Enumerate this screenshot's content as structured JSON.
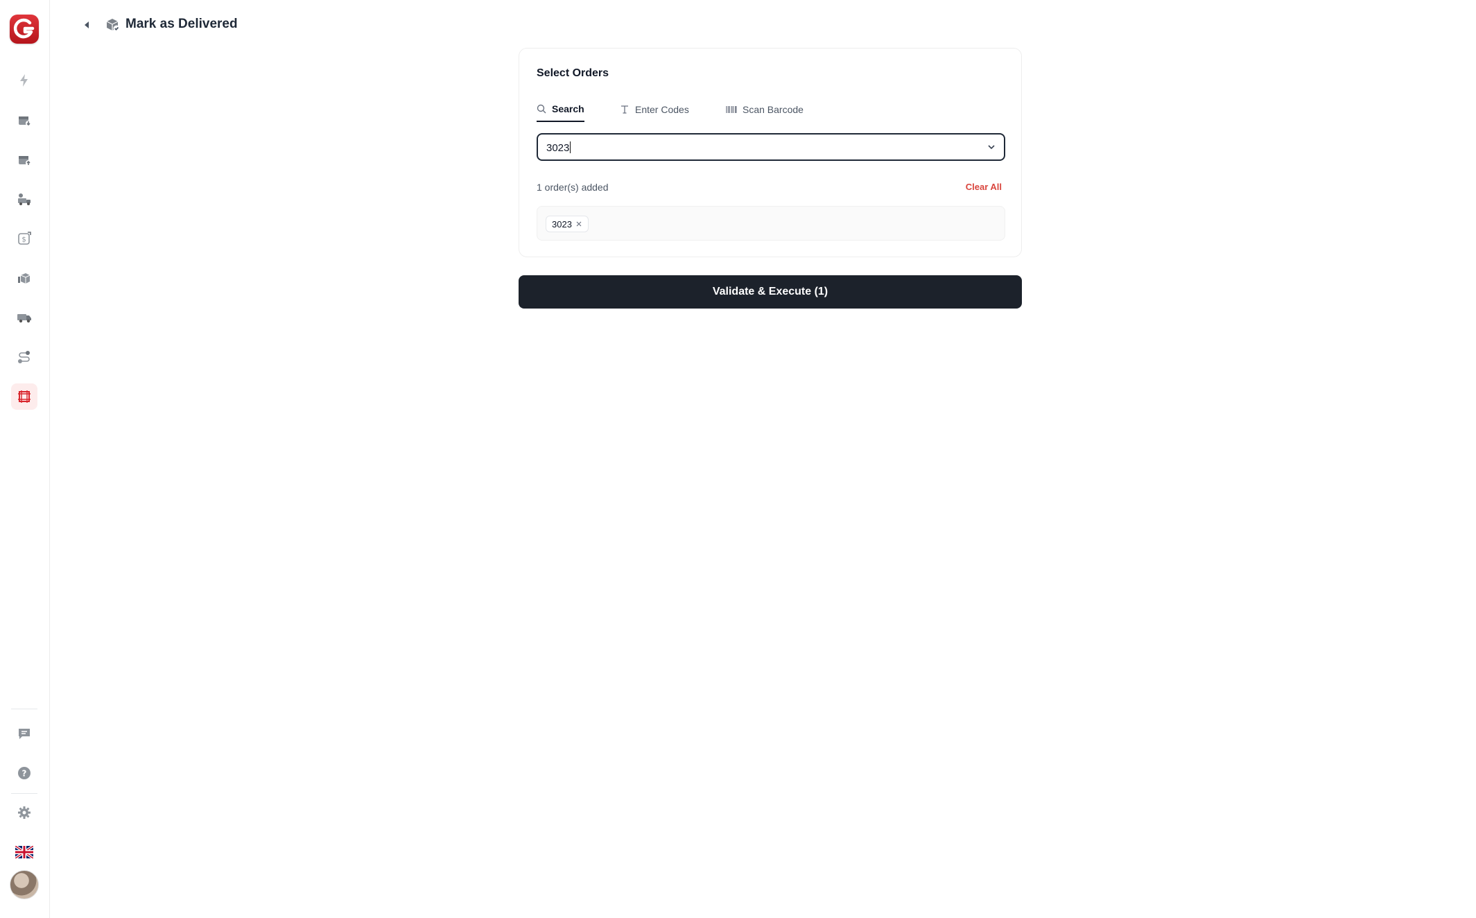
{
  "header": {
    "title": "Mark as Delivered"
  },
  "card": {
    "title": "Select Orders",
    "tabs": [
      {
        "label": "Search",
        "icon": "search-icon",
        "active": true
      },
      {
        "label": "Enter Codes",
        "icon": "text-cursor-icon",
        "active": false
      },
      {
        "label": "Scan Barcode",
        "icon": "barcode-icon",
        "active": false
      }
    ],
    "search": {
      "value": "3023"
    },
    "added_count": "1 order(s) added",
    "clear_all": "Clear All",
    "chips": [
      "3023"
    ]
  },
  "execute_label": "Validate & Execute (1)",
  "sidebar": {
    "items": [
      {
        "icon": "lightning-icon",
        "active": false
      },
      {
        "icon": "box-in-icon",
        "active": false
      },
      {
        "icon": "box-out-icon",
        "active": false
      },
      {
        "icon": "delivery-truck-icon",
        "active": false
      },
      {
        "icon": "cash-icon",
        "active": false
      },
      {
        "icon": "packages-icon",
        "active": false
      },
      {
        "icon": "shipping-truck-icon",
        "active": false
      },
      {
        "icon": "route-icon",
        "active": false
      },
      {
        "icon": "crop-frame-icon",
        "active": true
      }
    ],
    "bottom": [
      {
        "icon": "chat-icon"
      },
      {
        "icon": "help-icon"
      },
      {
        "icon": "settings-icon"
      },
      {
        "icon": "uk-flag-icon"
      }
    ]
  },
  "colors": {
    "brand": "#c81e24",
    "accent_dark": "#1c222b",
    "danger": "#d9453d",
    "icon_gray": "#9aa0a6"
  }
}
